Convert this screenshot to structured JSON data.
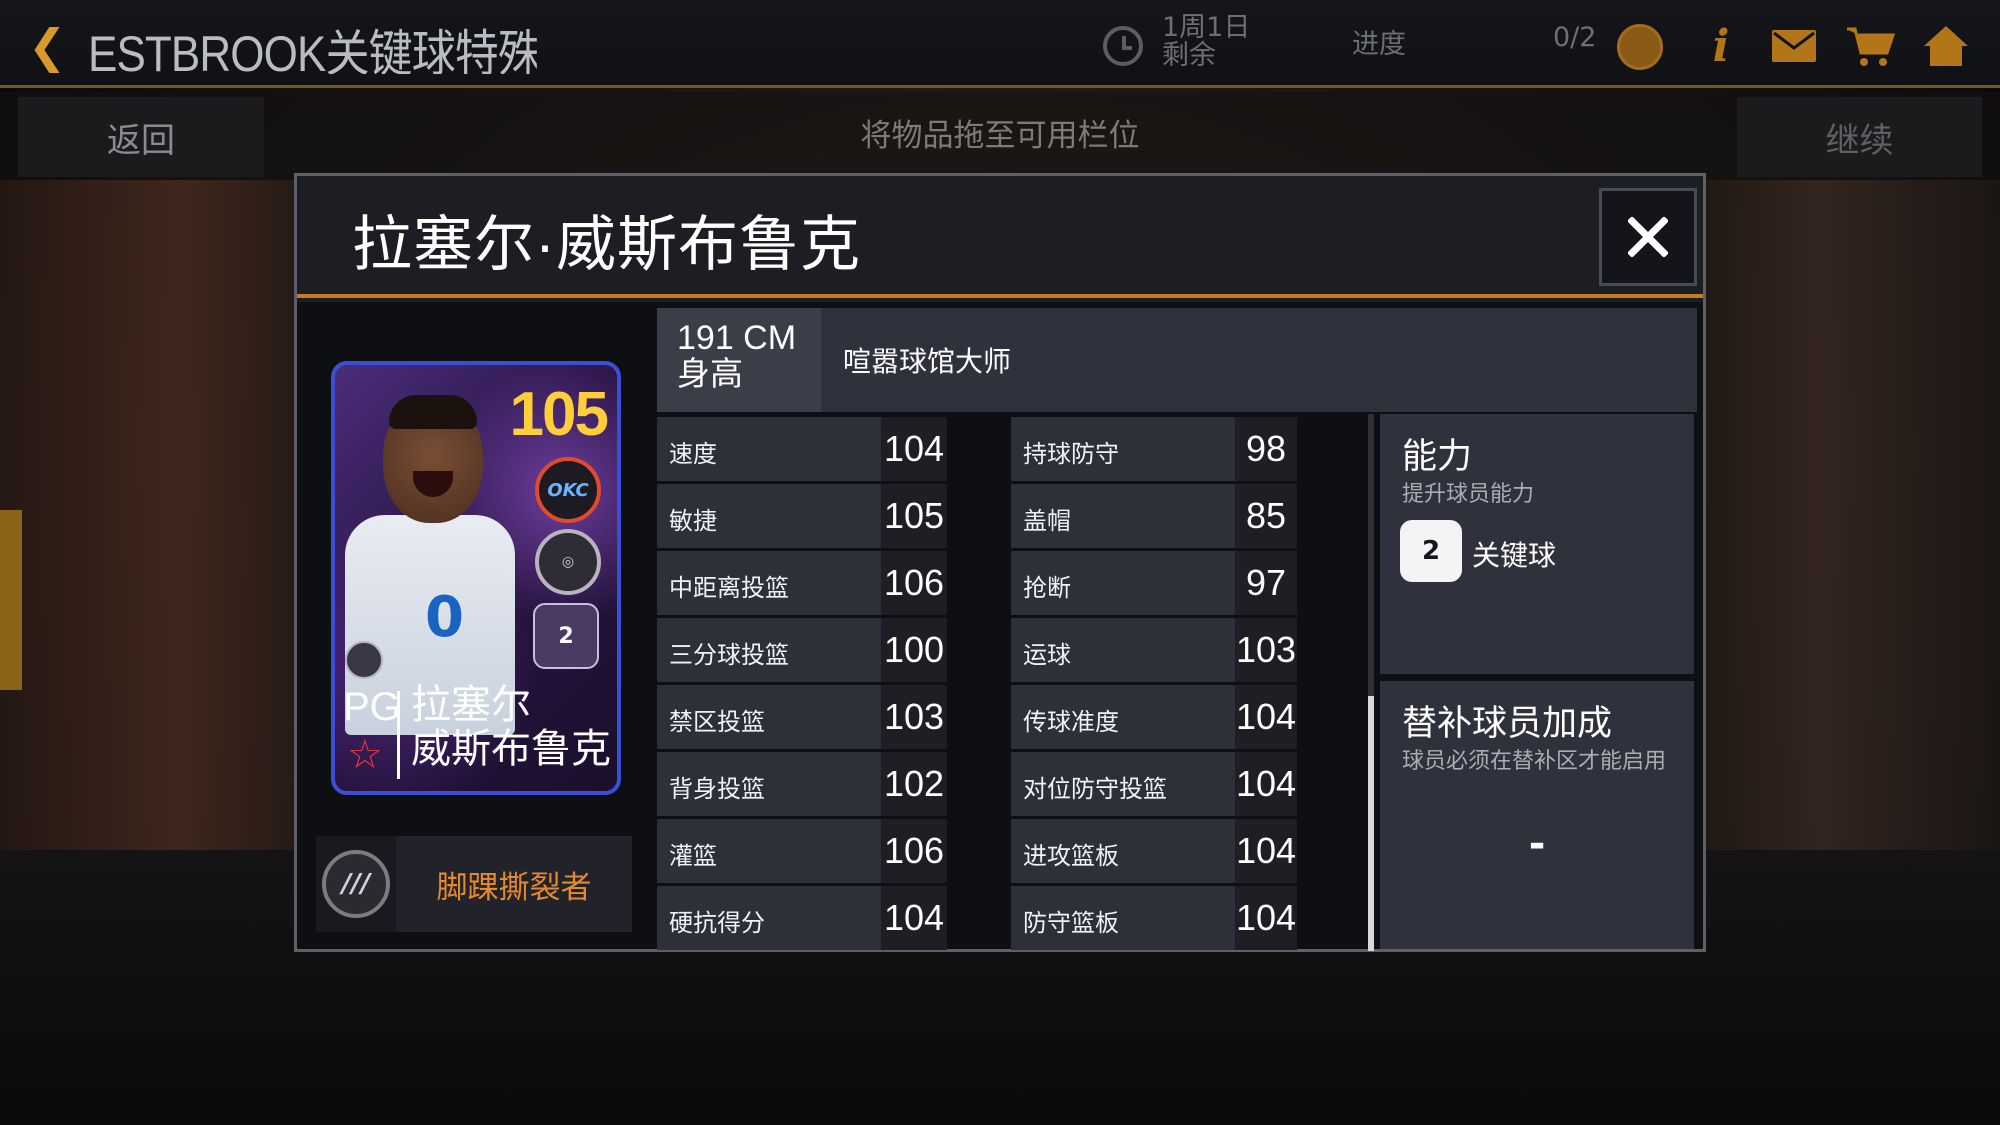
{
  "topbar": {
    "event_title": "ESTBROOK关键球特殊技能",
    "timer_line1": "1周1日",
    "timer_line2": "剩余",
    "progress_label": "进度",
    "progress_value": "0/2",
    "icons": [
      "back-chevron-icon",
      "clock-icon",
      "basketball-icon",
      "info-icon",
      "mail-icon",
      "cart-icon",
      "home-icon"
    ],
    "accent_color": "#d89a2a"
  },
  "subbar": {
    "back_label": "返回",
    "drag_hint": "将物品拖至可用栏位",
    "continue_label": "继续"
  },
  "modal": {
    "title": "拉塞尔·威斯布鲁克",
    "close_icon": "close-icon",
    "card": {
      "rating": "105",
      "position": "PG",
      "name_line1": "拉塞尔",
      "name_line2": "威斯布鲁克",
      "team_badge": "OKC",
      "jersey_number": "0",
      "badges": [
        "okc-team-badge-icon",
        "pro-badge-icon",
        "clutch-badge-icon",
        "claw-badge-icon",
        "star-icon"
      ]
    },
    "badge_bar": {
      "label": "脚踝撕裂者",
      "icon": "claw-badge-icon",
      "label_color": "#e58a2a"
    },
    "info": {
      "height_value": "191 CM",
      "height_label": "身高",
      "archetype": "喧嚣球馆大师"
    },
    "stats_left": [
      {
        "label": "速度",
        "value": "104"
      },
      {
        "label": "敏捷",
        "value": "105"
      },
      {
        "label": "中距离投篮",
        "value": "106"
      },
      {
        "label": "三分球投篮",
        "value": "100"
      },
      {
        "label": "禁区投篮",
        "value": "103"
      },
      {
        "label": "背身投篮",
        "value": "102"
      },
      {
        "label": "灌篮",
        "value": "106"
      },
      {
        "label": "硬抗得分",
        "value": "104"
      }
    ],
    "stats_right": [
      {
        "label": "持球防守",
        "value": "98"
      },
      {
        "label": "盖帽",
        "value": "85"
      },
      {
        "label": "抢断",
        "value": "97"
      },
      {
        "label": "运球",
        "value": "103"
      },
      {
        "label": "传球准度",
        "value": "104"
      },
      {
        "label": "对位防守投篮",
        "value": "104"
      },
      {
        "label": "进攻篮板",
        "value": "104"
      },
      {
        "label": "防守篮板",
        "value": "104"
      }
    ],
    "ability_panel": {
      "title": "能力",
      "subtitle": "提升球员能力",
      "item_name": "关键球",
      "item_icon": "clutch-icon"
    },
    "bench_panel": {
      "title": "替补球员加成",
      "subtitle": "球员必须在替补区才能启用",
      "value": "-"
    }
  }
}
